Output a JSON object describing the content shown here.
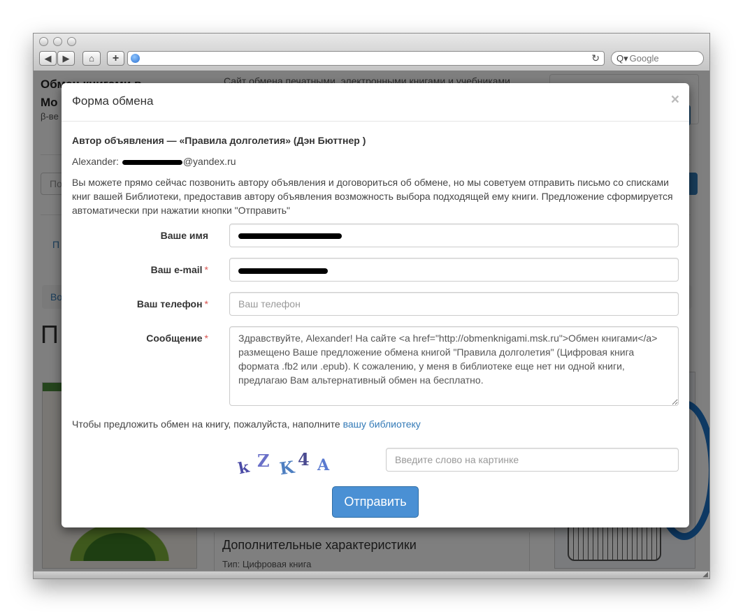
{
  "browser": {
    "search_placeholder": "Google",
    "address": ""
  },
  "background": {
    "logo_line1": "Обмен книгами в",
    "logo_line2": "Мо",
    "beta": "β-ве",
    "tagline": "Сайт обмена печатными, электронными книгами и учебниками",
    "search_placeholder": "По",
    "link": "П",
    "breadcrumb": "Во",
    "heading": "П",
    "panel_heading": "Дополнительные характеристики",
    "panel_type": "Тип: Цифровая книга"
  },
  "modal": {
    "title": "Форма обмена",
    "close": "×",
    "author_line": "Автор объявления — «Правила долголетия» (Дэн Бюттнер )",
    "contact_name": "Alexander:",
    "contact_domain": "@yandex.ru",
    "info": "Вы можете прямо сейчас позвонить автору объявления и договориться об обмене, но мы советуем отправить письмо со списками книг вашей Библиотеки, предоставив автору объявления возможность выбора подходящей ему книги. Предложение сформируется автоматически при нажатии кнопки \"Отправить\"",
    "form": {
      "name_label": "Ваше имя",
      "email_label": "Ваш e-mail",
      "phone_label": "Ваш телефон",
      "phone_placeholder": "Ваш телефон",
      "message_label": "Сообщение",
      "required_mark": "*",
      "message_value": "Здравствуйте, Alexander! На сайте <a href=\"http://obmenknigami.msk.ru\">Обмен книгами</a> размещено Ваше предложение обмена книгой \"Правила долголетия\" (Цифровая книга формата .fb2 или .epub). К сожалению, у меня в библиотеке еще нет ни одной книги, предлагаю Вам альтернативный обмен на бесплатно."
    },
    "fill_note": "Чтобы предложить обмен на книгу, пожалуйста, наполните",
    "fill_link": "вашу библиотеку",
    "captcha_letters": [
      "k",
      "Z",
      "K",
      "4",
      "A"
    ],
    "captcha_placeholder": "Введите слово на картинке",
    "submit": "Отправить"
  }
}
